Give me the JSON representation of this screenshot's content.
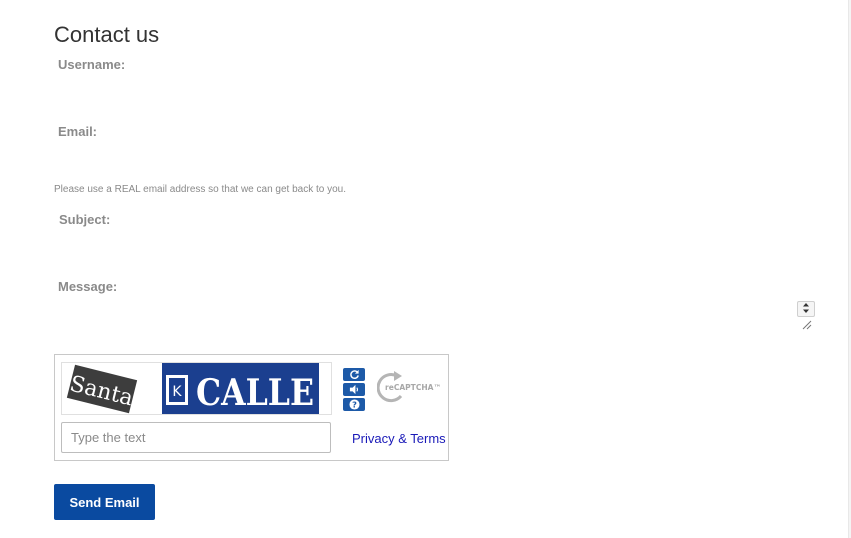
{
  "form": {
    "title": "Contact us",
    "username_label": "Username:",
    "email_label": "Email:",
    "email_help": "Please use a REAL email address so that we can get back to you.",
    "subject_label": "Subject:",
    "message_label": "Message:"
  },
  "captcha": {
    "word_left": "Santa",
    "word_badge": "K",
    "word_right": "CALLE",
    "brand": "reCAPTCHA™",
    "icons": [
      "refresh-icon",
      "audio-icon",
      "help-icon"
    ],
    "input_placeholder": "Type the text",
    "privacy_link": "Privacy & Terms"
  },
  "actions": {
    "send_label": "Send Email"
  },
  "colors": {
    "accent": "#0a4aa0",
    "captcha_button": "#1d5aa8",
    "label_gray": "#8a8a8a",
    "link_blue": "#1a1ab8"
  }
}
